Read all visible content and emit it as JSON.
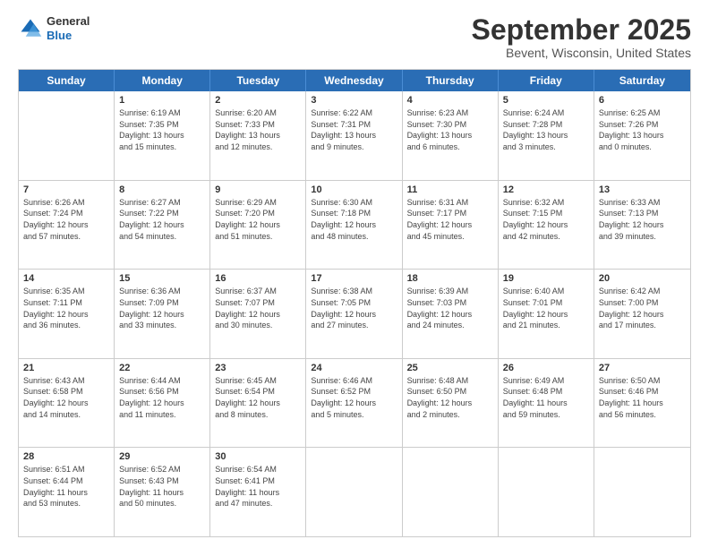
{
  "logo": {
    "general": "General",
    "blue": "Blue"
  },
  "title": "September 2025",
  "location": "Bevent, Wisconsin, United States",
  "days": [
    "Sunday",
    "Monday",
    "Tuesday",
    "Wednesday",
    "Thursday",
    "Friday",
    "Saturday"
  ],
  "weeks": [
    [
      {
        "date": "",
        "info": ""
      },
      {
        "date": "1",
        "info": "Sunrise: 6:19 AM\nSunset: 7:35 PM\nDaylight: 13 hours\nand 15 minutes."
      },
      {
        "date": "2",
        "info": "Sunrise: 6:20 AM\nSunset: 7:33 PM\nDaylight: 13 hours\nand 12 minutes."
      },
      {
        "date": "3",
        "info": "Sunrise: 6:22 AM\nSunset: 7:31 PM\nDaylight: 13 hours\nand 9 minutes."
      },
      {
        "date": "4",
        "info": "Sunrise: 6:23 AM\nSunset: 7:30 PM\nDaylight: 13 hours\nand 6 minutes."
      },
      {
        "date": "5",
        "info": "Sunrise: 6:24 AM\nSunset: 7:28 PM\nDaylight: 13 hours\nand 3 minutes."
      },
      {
        "date": "6",
        "info": "Sunrise: 6:25 AM\nSunset: 7:26 PM\nDaylight: 13 hours\nand 0 minutes."
      }
    ],
    [
      {
        "date": "7",
        "info": "Sunrise: 6:26 AM\nSunset: 7:24 PM\nDaylight: 12 hours\nand 57 minutes."
      },
      {
        "date": "8",
        "info": "Sunrise: 6:27 AM\nSunset: 7:22 PM\nDaylight: 12 hours\nand 54 minutes."
      },
      {
        "date": "9",
        "info": "Sunrise: 6:29 AM\nSunset: 7:20 PM\nDaylight: 12 hours\nand 51 minutes."
      },
      {
        "date": "10",
        "info": "Sunrise: 6:30 AM\nSunset: 7:18 PM\nDaylight: 12 hours\nand 48 minutes."
      },
      {
        "date": "11",
        "info": "Sunrise: 6:31 AM\nSunset: 7:17 PM\nDaylight: 12 hours\nand 45 minutes."
      },
      {
        "date": "12",
        "info": "Sunrise: 6:32 AM\nSunset: 7:15 PM\nDaylight: 12 hours\nand 42 minutes."
      },
      {
        "date": "13",
        "info": "Sunrise: 6:33 AM\nSunset: 7:13 PM\nDaylight: 12 hours\nand 39 minutes."
      }
    ],
    [
      {
        "date": "14",
        "info": "Sunrise: 6:35 AM\nSunset: 7:11 PM\nDaylight: 12 hours\nand 36 minutes."
      },
      {
        "date": "15",
        "info": "Sunrise: 6:36 AM\nSunset: 7:09 PM\nDaylight: 12 hours\nand 33 minutes."
      },
      {
        "date": "16",
        "info": "Sunrise: 6:37 AM\nSunset: 7:07 PM\nDaylight: 12 hours\nand 30 minutes."
      },
      {
        "date": "17",
        "info": "Sunrise: 6:38 AM\nSunset: 7:05 PM\nDaylight: 12 hours\nand 27 minutes."
      },
      {
        "date": "18",
        "info": "Sunrise: 6:39 AM\nSunset: 7:03 PM\nDaylight: 12 hours\nand 24 minutes."
      },
      {
        "date": "19",
        "info": "Sunrise: 6:40 AM\nSunset: 7:01 PM\nDaylight: 12 hours\nand 21 minutes."
      },
      {
        "date": "20",
        "info": "Sunrise: 6:42 AM\nSunset: 7:00 PM\nDaylight: 12 hours\nand 17 minutes."
      }
    ],
    [
      {
        "date": "21",
        "info": "Sunrise: 6:43 AM\nSunset: 6:58 PM\nDaylight: 12 hours\nand 14 minutes."
      },
      {
        "date": "22",
        "info": "Sunrise: 6:44 AM\nSunset: 6:56 PM\nDaylight: 12 hours\nand 11 minutes."
      },
      {
        "date": "23",
        "info": "Sunrise: 6:45 AM\nSunset: 6:54 PM\nDaylight: 12 hours\nand 8 minutes."
      },
      {
        "date": "24",
        "info": "Sunrise: 6:46 AM\nSunset: 6:52 PM\nDaylight: 12 hours\nand 5 minutes."
      },
      {
        "date": "25",
        "info": "Sunrise: 6:48 AM\nSunset: 6:50 PM\nDaylight: 12 hours\nand 2 minutes."
      },
      {
        "date": "26",
        "info": "Sunrise: 6:49 AM\nSunset: 6:48 PM\nDaylight: 11 hours\nand 59 minutes."
      },
      {
        "date": "27",
        "info": "Sunrise: 6:50 AM\nSunset: 6:46 PM\nDaylight: 11 hours\nand 56 minutes."
      }
    ],
    [
      {
        "date": "28",
        "info": "Sunrise: 6:51 AM\nSunset: 6:44 PM\nDaylight: 11 hours\nand 53 minutes."
      },
      {
        "date": "29",
        "info": "Sunrise: 6:52 AM\nSunset: 6:43 PM\nDaylight: 11 hours\nand 50 minutes."
      },
      {
        "date": "30",
        "info": "Sunrise: 6:54 AM\nSunset: 6:41 PM\nDaylight: 11 hours\nand 47 minutes."
      },
      {
        "date": "",
        "info": ""
      },
      {
        "date": "",
        "info": ""
      },
      {
        "date": "",
        "info": ""
      },
      {
        "date": "",
        "info": ""
      }
    ]
  ]
}
